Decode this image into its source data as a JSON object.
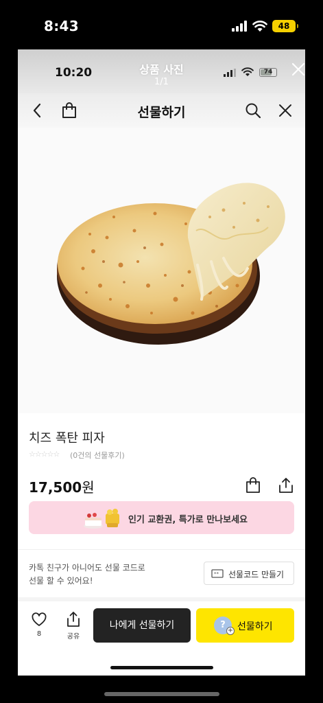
{
  "outer_status": {
    "time": "8:43",
    "battery": "48"
  },
  "viewer": {
    "time": "10:20",
    "title": "상품 사진",
    "counter": "1/1",
    "battery": "74"
  },
  "header": {
    "title": "선물하기"
  },
  "product": {
    "name": "치즈 폭탄 피자",
    "rating_stars": "☆☆☆☆☆",
    "review_text": "(0건의 선물후기)",
    "price": "17,500",
    "price_unit": "원"
  },
  "banner": {
    "text": "인기 교환권, 특가로 만나보세요"
  },
  "gift_code": {
    "note_line1": "카톡 친구가 아니어도 선물 코드로",
    "note_line2": "선물 할 수 있어요!",
    "button_label": "선물코드 만들기"
  },
  "bottom_bar": {
    "like_count": "8",
    "share_label": "공유",
    "self_gift_label": "나에게 선물하기",
    "gift_label": "선물하기",
    "avatar_glyph": "?",
    "plus_glyph": "+"
  },
  "colors": {
    "accent": "#fee500",
    "dark_button": "#232323",
    "banner_bg": "#fcd7e3"
  }
}
